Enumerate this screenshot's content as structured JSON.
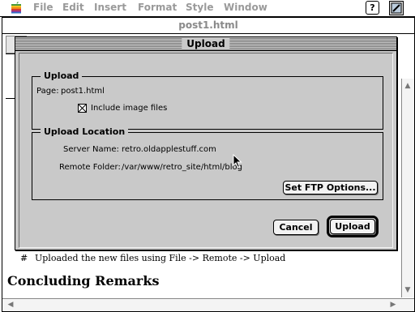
{
  "menubar": {
    "items": [
      "File",
      "Edit",
      "Insert",
      "Format",
      "Style",
      "Window"
    ],
    "help_label": "?"
  },
  "document": {
    "title": "post1.html",
    "bullet_mark": "#",
    "bullet_text": "Uploaded the new files using File -> Remote -> Upload",
    "heading": "Concluding Remarks"
  },
  "dialog": {
    "title": "Upload",
    "upload_group": {
      "title": "Upload",
      "page_label": "Page:",
      "page_value": "post1.html",
      "include_images_label": "Include image files",
      "include_images_checked": true
    },
    "location_group": {
      "title": "Upload Location",
      "server_label": "Server Name:",
      "server_value": "retro.oldapplestuff.com",
      "folder_label": "Remote Folder:",
      "folder_value": "/var/www/retro_site/html/blog",
      "ftp_button": "Set FTP Options..."
    },
    "cancel_button": "Cancel",
    "upload_button": "Upload"
  }
}
